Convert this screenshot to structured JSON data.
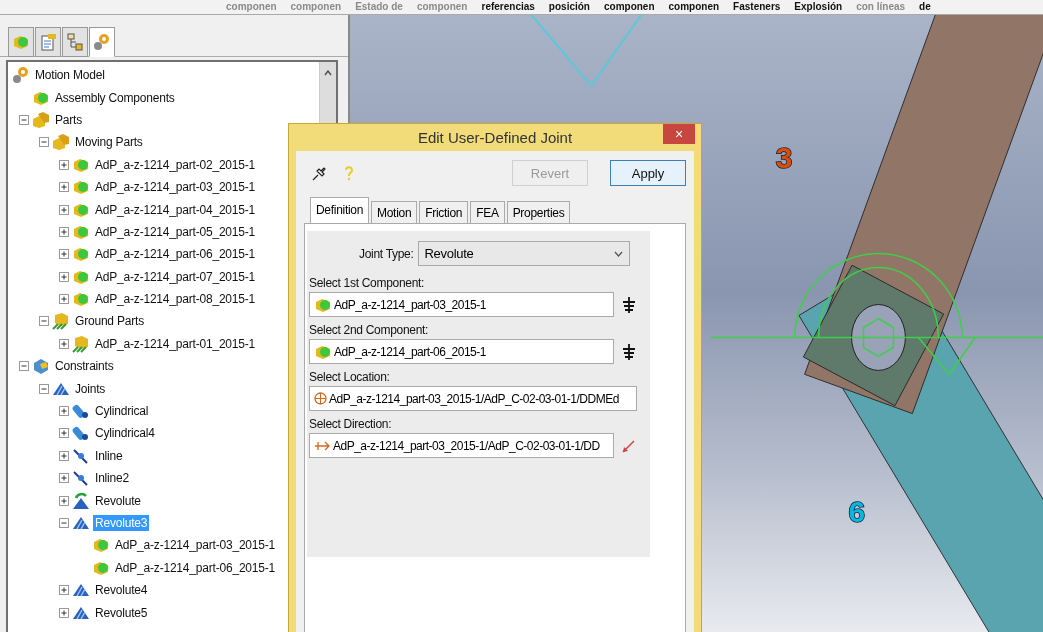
{
  "ribbon_labels": [
    {
      "text": "componen",
      "disabled": true
    },
    {
      "text": "componen",
      "disabled": true
    },
    {
      "text": "Estado de",
      "disabled": true
    },
    {
      "text": "componen",
      "disabled": true
    },
    {
      "text": "referencias",
      "disabled": false
    },
    {
      "text": "posición",
      "disabled": false
    },
    {
      "text": "componen",
      "disabled": false
    },
    {
      "text": "componen",
      "disabled": false
    },
    {
      "text": "Fasteners",
      "disabled": false
    },
    {
      "text": "Explosión",
      "disabled": false
    },
    {
      "text": "con líneas",
      "disabled": true
    },
    {
      "text": "de",
      "disabled": false
    }
  ],
  "panel_tabs": [
    {
      "kind": "components",
      "selected": false
    },
    {
      "kind": "properties",
      "selected": false
    },
    {
      "kind": "config",
      "selected": false
    },
    {
      "kind": "motion",
      "selected": true
    }
  ],
  "tree": [
    {
      "label": "Motion Model",
      "kind": "motion",
      "selected": false,
      "children": [
        {
          "label": "Assembly Components",
          "kind": "component",
          "selected": false
        },
        {
          "label": "Parts",
          "kind": "parts",
          "expanded": true,
          "selected": false,
          "children": [
            {
              "label": "Moving Parts",
              "kind": "parts",
              "expanded": true,
              "selected": false,
              "children": [
                {
                  "label": "AdP_a-z-1214_part-02_2015-1",
                  "kind": "component",
                  "expanded": false,
                  "selected": false
                },
                {
                  "label": "AdP_a-z-1214_part-03_2015-1",
                  "kind": "component",
                  "expanded": false,
                  "selected": false
                },
                {
                  "label": "AdP_a-z-1214_part-04_2015-1",
                  "kind": "component",
                  "expanded": false,
                  "selected": false
                },
                {
                  "label": "AdP_a-z-1214_part-05_2015-1",
                  "kind": "component",
                  "expanded": false,
                  "selected": false
                },
                {
                  "label": "AdP_a-z-1214_part-06_2015-1",
                  "kind": "component",
                  "expanded": false,
                  "selected": false
                },
                {
                  "label": "AdP_a-z-1214_part-07_2015-1",
                  "kind": "component",
                  "expanded": false,
                  "selected": false
                },
                {
                  "label": "AdP_a-z-1214_part-08_2015-1",
                  "kind": "component",
                  "expanded": false,
                  "selected": false
                }
              ]
            },
            {
              "label": "Ground Parts",
              "kind": "ground",
              "expanded": true,
              "selected": false,
              "children": [
                {
                  "label": "AdP_a-z-1214_part-01_2015-1",
                  "kind": "ground",
                  "expanded": false,
                  "selected": false
                }
              ]
            }
          ]
        },
        {
          "label": "Constraints",
          "kind": "constraints",
          "expanded": true,
          "selected": false,
          "children": [
            {
              "label": "Joints",
              "kind": "joints",
              "expanded": true,
              "selected": false,
              "children": [
                {
                  "label": "Cylindrical",
                  "kind": "cylindrical",
                  "expanded": false,
                  "selected": false
                },
                {
                  "label": "Cylindrical4",
                  "kind": "cylindrical",
                  "expanded": false,
                  "selected": false
                },
                {
                  "label": "Inline",
                  "kind": "inline",
                  "expanded": false,
                  "selected": false
                },
                {
                  "label": "Inline2",
                  "kind": "inline",
                  "expanded": false,
                  "selected": false
                },
                {
                  "label": "Revolute",
                  "kind": "revolute",
                  "expanded": false,
                  "selected": false
                },
                {
                  "label": "Revolute3",
                  "kind": "joints",
                  "expanded": true,
                  "selected": true,
                  "children": [
                    {
                      "label": "AdP_a-z-1214_part-03_2015-1",
                      "kind": "component",
                      "selected": false
                    },
                    {
                      "label": "AdP_a-z-1214_part-06_2015-1",
                      "kind": "component",
                      "selected": false
                    }
                  ]
                },
                {
                  "label": "Revolute4",
                  "kind": "joints",
                  "expanded": false,
                  "selected": false
                },
                {
                  "label": "Revolute5",
                  "kind": "joints",
                  "expanded": false,
                  "selected": false
                }
              ]
            }
          ]
        }
      ]
    }
  ],
  "dialog": {
    "title": "Edit User-Defined Joint",
    "close": "×",
    "buttons": [
      {
        "label": "Revert",
        "disabled": true
      },
      {
        "label": "Apply",
        "disabled": false
      }
    ],
    "tabs": [
      {
        "label": "Definition",
        "selected": true
      },
      {
        "label": "Motion",
        "selected": false
      },
      {
        "label": "Friction",
        "selected": false
      },
      {
        "label": "FEA",
        "selected": false
      },
      {
        "label": "Properties",
        "selected": false
      }
    ],
    "joint_type": {
      "label": "Joint Type:",
      "value": "Revolute"
    },
    "fields": [
      {
        "label": "Select 1st Component:",
        "value": "AdP_a-z-1214_part-03_2015-1",
        "kind": "component"
      },
      {
        "label": "Select 2nd Component:",
        "value": "AdP_a-z-1214_part-06_2015-1",
        "kind": "component"
      },
      {
        "label": "Select Location:",
        "value": "AdP_a-z-1214_part-03_2015-1/AdP_C-02-03-01-1/DDMEd",
        "kind": "location"
      },
      {
        "label": "Select Direction:",
        "value": "AdP_a-z-1214_part-03_2015-1/AdP_C-02-03-01-1/DD",
        "kind": "direction"
      }
    ]
  },
  "viewport": {
    "labels": [
      {
        "text": "3",
        "color": "#d4500c"
      },
      {
        "text": "6",
        "color": "#00b8e0"
      }
    ]
  }
}
